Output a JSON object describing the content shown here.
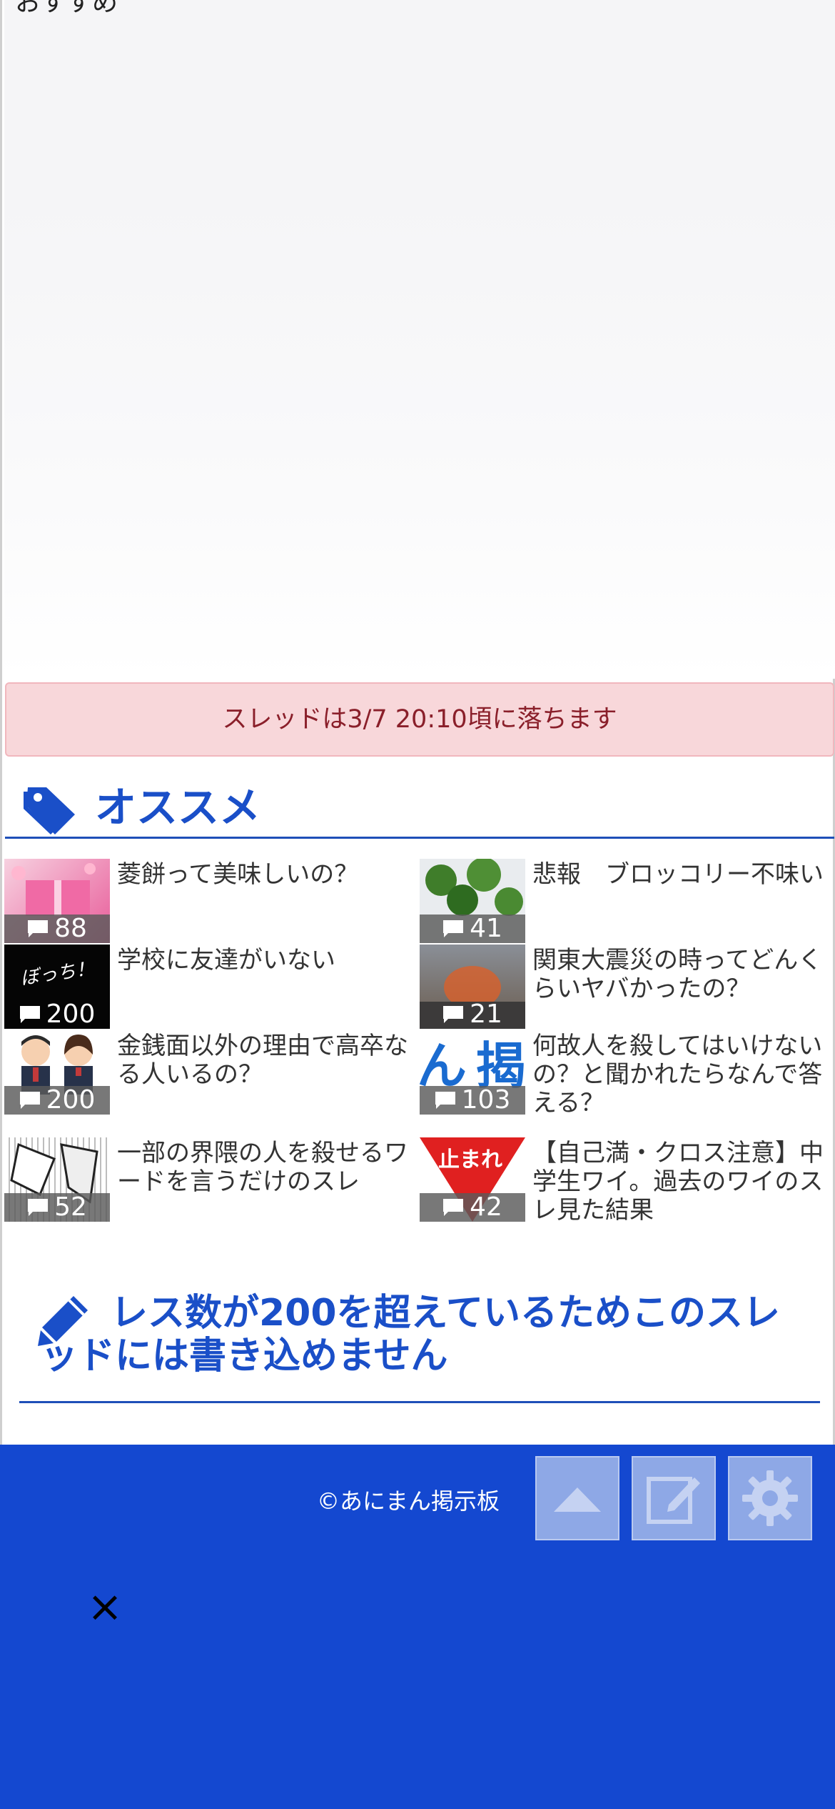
{
  "top": {
    "partial_text": "おすすめ"
  },
  "alert": {
    "text": "スレッドは3/7 20:10頃に落ちます"
  },
  "recommend": {
    "title": "オススメ",
    "items": [
      {
        "title": "菱餅って美味しいの？",
        "count": "88",
        "thumb": "pink-gift"
      },
      {
        "title": "悲報　ブロッコリー不味い",
        "count": "41",
        "thumb": "broccoli"
      },
      {
        "title": "学校に友達がいない",
        "count": "200",
        "thumb": "alone"
      },
      {
        "title": "関東大震災の時ってどんくらいヤバかったの？",
        "count": "21",
        "thumb": "fire-city"
      },
      {
        "title": "金銭面以外の理由で高卒なる人いるの？",
        "count": "200",
        "thumb": "students"
      },
      {
        "title": "何故人を殺してはいけないの？と聞かれたらなんで答える？",
        "count": "103",
        "thumb": "logo-text"
      },
      {
        "title": "一部の界隈の人を殺せるワードを言うだけのスレ",
        "count": "52",
        "thumb": "manga"
      },
      {
        "title": "【自己満・クロス注意】中学生ワイ。過去のワイのスレ見た結果",
        "count": "42",
        "thumb": "stop-sign"
      }
    ],
    "thumb_labels": {
      "alone": "ぼっち！",
      "logo": "ん 揭",
      "stop": "止まれ"
    }
  },
  "write": {
    "title": "レス数が200を超えているためこのスレッドには書き込めません"
  },
  "footer": {
    "copyright": "©あにまん掲示板",
    "close_symbol": "×"
  },
  "colors": {
    "brand": "#1448d0",
    "heading": "#1a4fc8",
    "alert_bg": "#f8d7da",
    "alert_text": "#8a1f2a"
  }
}
